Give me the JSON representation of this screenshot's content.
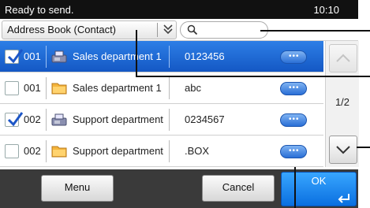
{
  "status": {
    "text": "Ready to send.",
    "time": "10:10"
  },
  "toolbar": {
    "address_book_label": "Address Book (Contact)",
    "search_placeholder": ""
  },
  "rows": [
    {
      "number": "001",
      "name": "Sales department 1",
      "destination": "0123456",
      "checked": true,
      "selected": true,
      "type_icon": "fax-icon"
    },
    {
      "number": "001",
      "name": "Sales department 1",
      "destination": "abc",
      "checked": false,
      "selected": false,
      "type_icon": "folder-icon"
    },
    {
      "number": "002",
      "name": "Support department",
      "destination": "0234567",
      "checked": true,
      "selected": false,
      "type_icon": "fax-icon"
    },
    {
      "number": "002",
      "name": "Support department",
      "destination": ".BOX",
      "checked": false,
      "selected": false,
      "type_icon": "folder-icon"
    }
  ],
  "pagination": {
    "indicator": "1/2"
  },
  "buttons": {
    "menu": "Menu",
    "cancel": "Cancel",
    "ok": "OK"
  },
  "side_code": "",
  "colors": {
    "selected_row": "#1a64d3",
    "accent": "#1e84f0"
  }
}
